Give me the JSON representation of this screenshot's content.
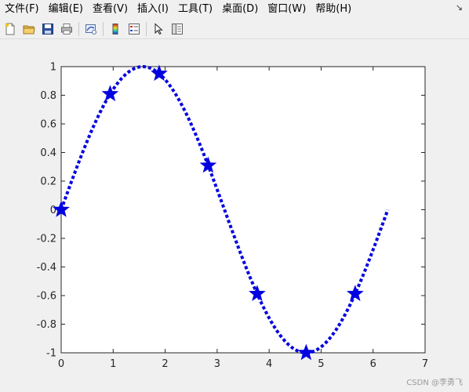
{
  "menu": {
    "items": [
      "文件(F)",
      "编辑(E)",
      "查看(V)",
      "插入(I)",
      "工具(T)",
      "桌面(D)",
      "窗口(W)",
      "帮助(H)"
    ],
    "overflow_icon": "pin-arrow-icon"
  },
  "toolbar": {
    "buttons": [
      {
        "name": "new-figure-button",
        "icon": "new-file-icon"
      },
      {
        "name": "open-file-button",
        "icon": "folder-icon"
      },
      {
        "name": "save-button",
        "icon": "save-disk-icon"
      },
      {
        "name": "print-button",
        "icon": "printer-icon"
      },
      {
        "name": "link-plot-button",
        "icon": "link-plot-icon"
      },
      {
        "name": "insert-colorbar-button",
        "icon": "colorbar-icon"
      },
      {
        "name": "insert-legend-button",
        "icon": "legend-icon"
      },
      {
        "name": "edit-plot-button",
        "icon": "pointer-icon"
      },
      {
        "name": "property-inspector-button",
        "icon": "panel-icon"
      }
    ]
  },
  "chart_data": {
    "type": "line",
    "series": [
      {
        "function": "sin(x)",
        "line_style": "dotted",
        "color": "#0000e0",
        "x_range": [
          0,
          6.283
        ],
        "markers": {
          "symbol": "star",
          "x": [
            0,
            0.942,
            1.885,
            2.827,
            3.77,
            4.712,
            5.655
          ],
          "y": [
            0,
            0.809,
            0.951,
            0.309,
            -0.588,
            -1.0,
            -0.588
          ]
        }
      }
    ],
    "xlim": [
      0,
      7
    ],
    "ylim": [
      -1,
      1
    ],
    "xticks": [
      "0",
      "1",
      "2",
      "3",
      "4",
      "5",
      "6",
      "7"
    ],
    "yticks": [
      "-1",
      "-0.8",
      "-0.6",
      "-0.4",
      "-0.2",
      "0",
      "0.2",
      "0.4",
      "0.6",
      "0.8",
      "1"
    ],
    "grid": false,
    "title": "",
    "xlabel": "",
    "ylabel": ""
  },
  "watermark": "CSDN @李勇飞"
}
